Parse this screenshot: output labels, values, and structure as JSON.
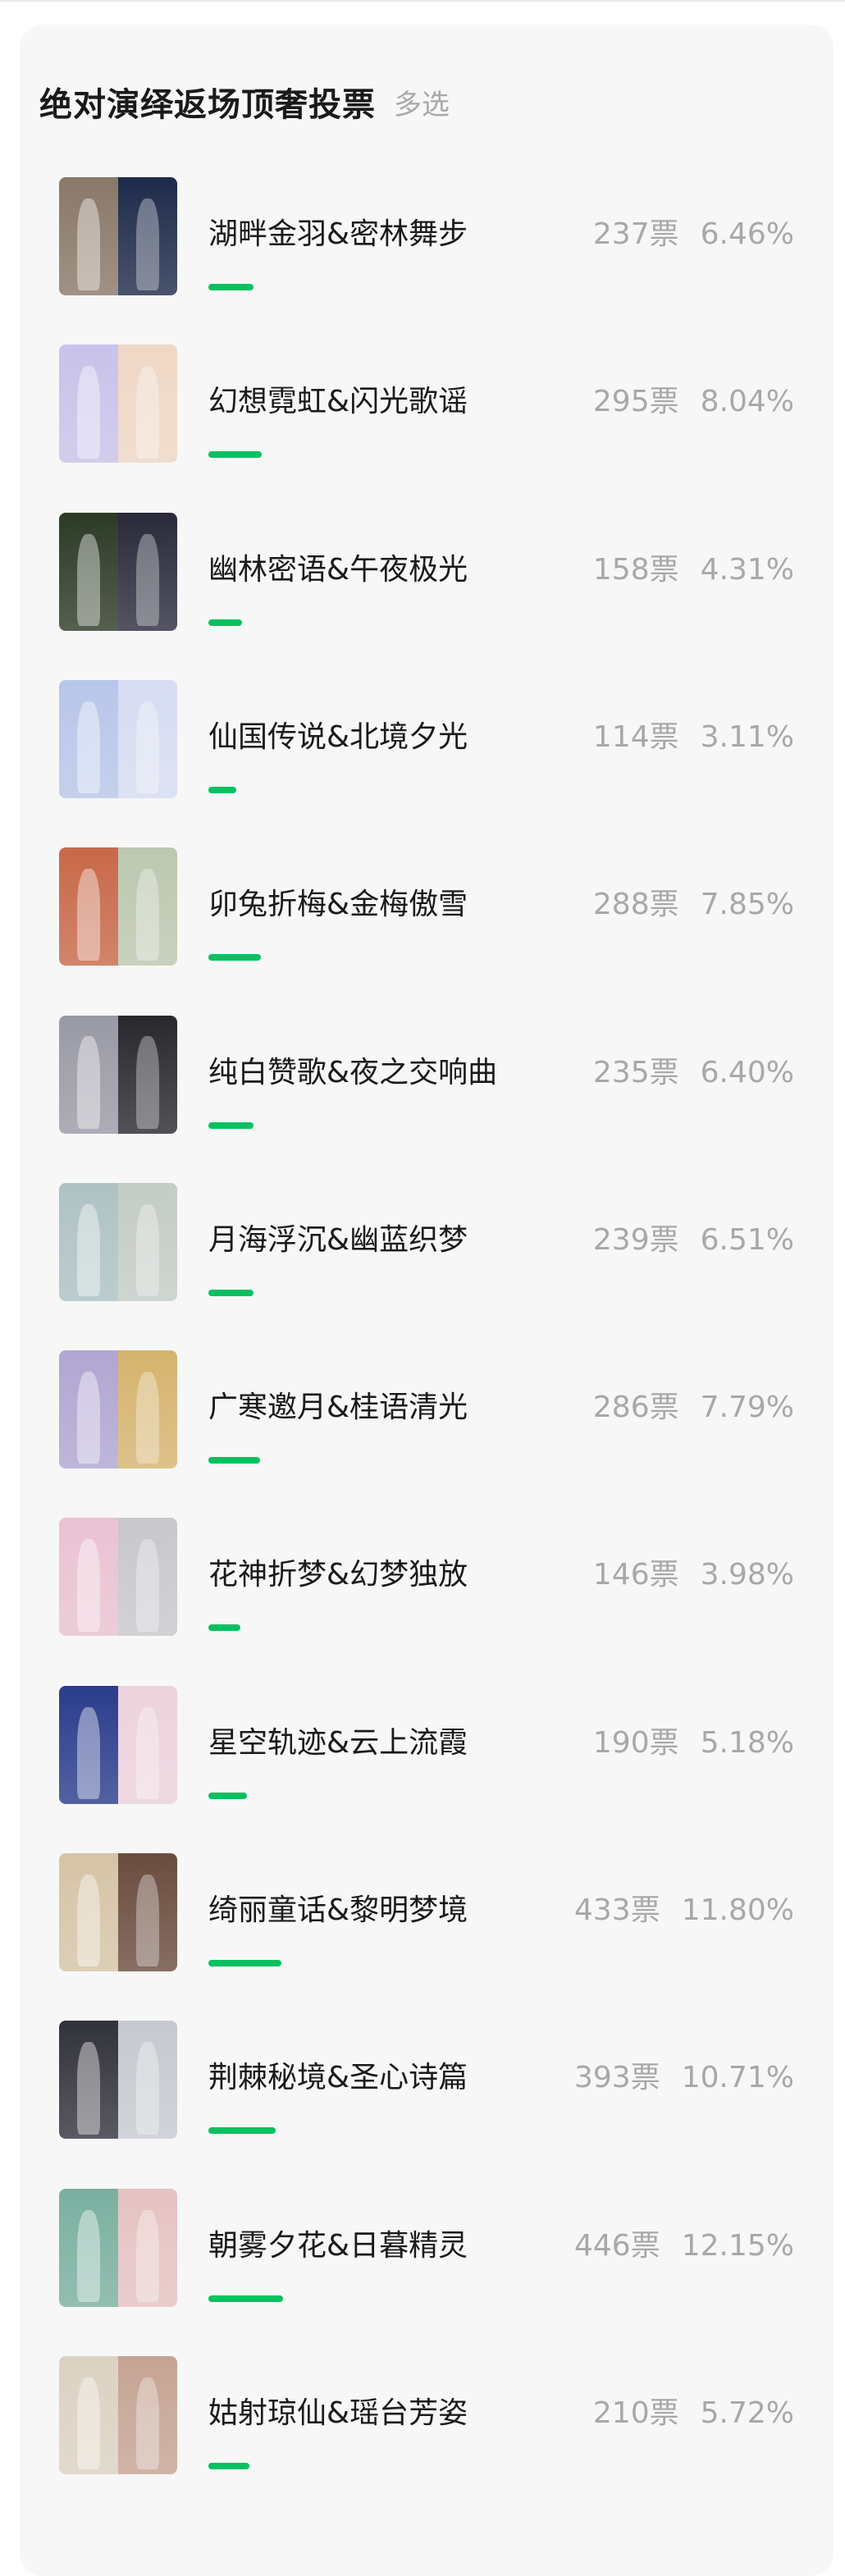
{
  "poll": {
    "title": "绝对演绎返场顶奢投票",
    "mode": "多选",
    "accent_color": "#07c160",
    "options": [
      {
        "name": "湖畔金羽&密林舞步",
        "votes": "237票",
        "percent": "6.46%",
        "share": 0.0646,
        "thumb_colors": [
          "#8a7868",
          "#1e2a4a"
        ]
      },
      {
        "name": "幻想霓虹&闪光歌谣",
        "votes": "295票",
        "percent": "8.04%",
        "share": 0.0804,
        "thumb_colors": [
          "#c9c2ea",
          "#efd7c4"
        ]
      },
      {
        "name": "幽林密语&午夜极光",
        "votes": "158票",
        "percent": "4.31%",
        "share": 0.0431,
        "thumb_colors": [
          "#2c3a26",
          "#2a2a3c"
        ]
      },
      {
        "name": "仙国传说&北境夕光",
        "votes": "114票",
        "percent": "3.11%",
        "share": 0.0311,
        "thumb_colors": [
          "#b8c6ea",
          "#d6dcf2"
        ]
      },
      {
        "name": "卯兔折梅&金梅傲雪",
        "votes": "288票",
        "percent": "7.85%",
        "share": 0.0785,
        "thumb_colors": [
          "#c86848",
          "#bcc8b0"
        ]
      },
      {
        "name": "纯白赞歌&夜之交响曲",
        "votes": "235票",
        "percent": "6.40%",
        "share": 0.064,
        "thumb_colors": [
          "#9a9aa6",
          "#28282e"
        ]
      },
      {
        "name": "月海浮沉&幽蓝织梦",
        "votes": "239票",
        "percent": "6.51%",
        "share": 0.0651,
        "thumb_colors": [
          "#aec2c4",
          "#c4ccc6"
        ]
      },
      {
        "name": "广寒邀月&桂语清光",
        "votes": "286票",
        "percent": "7.79%",
        "share": 0.0779,
        "thumb_colors": [
          "#b0a6d2",
          "#d6b46e"
        ]
      },
      {
        "name": "花神折梦&幻梦独放",
        "votes": "146票",
        "percent": "3.98%",
        "share": 0.0398,
        "thumb_colors": [
          "#eac2d2",
          "#c8c8cc"
        ]
      },
      {
        "name": "星空轨迹&云上流霞",
        "votes": "190票",
        "percent": "5.18%",
        "share": 0.0518,
        "thumb_colors": [
          "#2a3c8c",
          "#ecd2dc"
        ]
      },
      {
        "name": "绮丽童话&黎明梦境",
        "votes": "433票",
        "percent": "11.80%",
        "share": 0.118,
        "thumb_colors": [
          "#d6c4a6",
          "#6a4c3e"
        ]
      },
      {
        "name": "荆棘秘境&圣心诗篇",
        "votes": "393票",
        "percent": "10.71%",
        "share": 0.1071,
        "thumb_colors": [
          "#32323c",
          "#c6cad0"
        ]
      },
      {
        "name": "朝雾夕花&日暮精灵",
        "votes": "446票",
        "percent": "12.15%",
        "share": 0.1215,
        "thumb_colors": [
          "#7ab0a0",
          "#e6c2c2"
        ]
      },
      {
        "name": "姑射琼仙&瑶台芳姿",
        "votes": "210票",
        "percent": "5.72%",
        "share": 0.0572,
        "thumb_colors": [
          "#dcd2c2",
          "#c6a494"
        ]
      }
    ]
  }
}
